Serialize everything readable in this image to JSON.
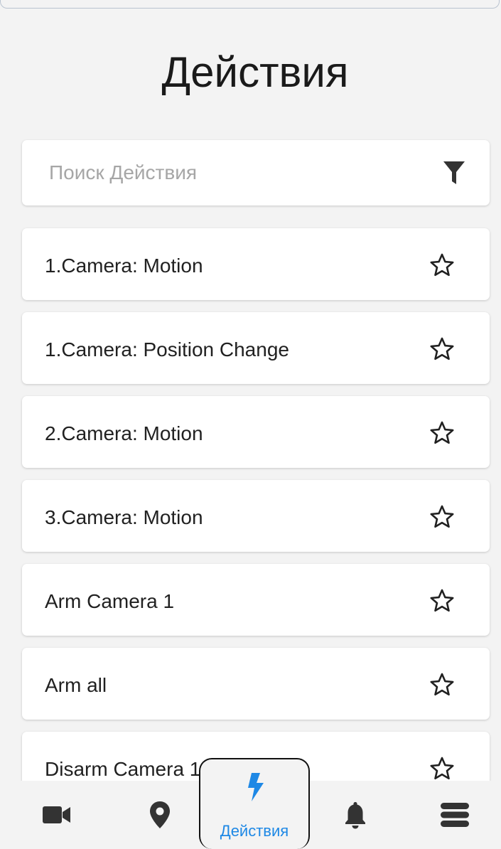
{
  "header": {
    "title": "Действия"
  },
  "search": {
    "placeholder": "Поиск Действия",
    "value": "",
    "filter_icon": "filter-icon"
  },
  "actions": [
    {
      "label": "1.Camera: Motion",
      "favorite": false
    },
    {
      "label": "1.Camera: Position Change",
      "favorite": false
    },
    {
      "label": "2.Camera: Motion",
      "favorite": false
    },
    {
      "label": "3.Camera: Motion",
      "favorite": false
    },
    {
      "label": "Arm Camera 1",
      "favorite": false
    },
    {
      "label": "Arm all",
      "favorite": false
    },
    {
      "label": "Disarm Camera 1",
      "favorite": false
    }
  ],
  "bottom_nav": {
    "items": [
      {
        "icon": "video-camera-icon",
        "label": ""
      },
      {
        "icon": "map-pin-icon",
        "label": ""
      },
      {
        "icon": "lightning-icon",
        "label": "Действия",
        "active": true
      },
      {
        "icon": "bell-icon",
        "label": ""
      },
      {
        "icon": "menu-icon",
        "label": ""
      }
    ]
  },
  "colors": {
    "accent": "#1e88e5",
    "background": "#f3f3f3",
    "card": "#ffffff",
    "text": "#212121"
  }
}
